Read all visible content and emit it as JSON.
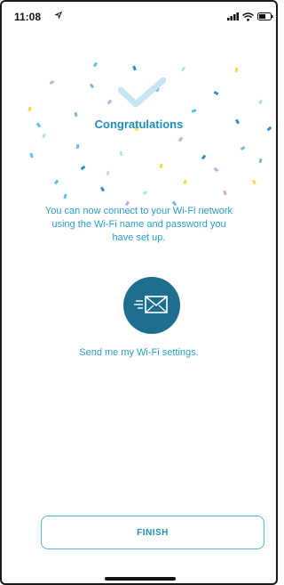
{
  "status_bar": {
    "time": "11:08",
    "icons": [
      "location-arrow-icon",
      "cellular-signal-icon",
      "wifi-icon",
      "battery-icon"
    ]
  },
  "confirmation": {
    "title": "Congratulations",
    "message": "You can now connect to your Wi-Fi network\nusing the Wi-Fi name and password you\nhave set up.",
    "icon": "checkmark-icon"
  },
  "share": {
    "icon": "envelope-send-icon",
    "link_text": "Send me my Wi-Fi settings."
  },
  "footer": {
    "finish_label": "FINISH"
  },
  "colors": {
    "accent": "#1f8dbd",
    "mail_circle": "#1d6e8f",
    "confetti": [
      "#5cc2e4",
      "#2b8fc4",
      "#b7dff0",
      "#fbd84c",
      "#cfa6e0",
      "#7ab9d8"
    ]
  }
}
